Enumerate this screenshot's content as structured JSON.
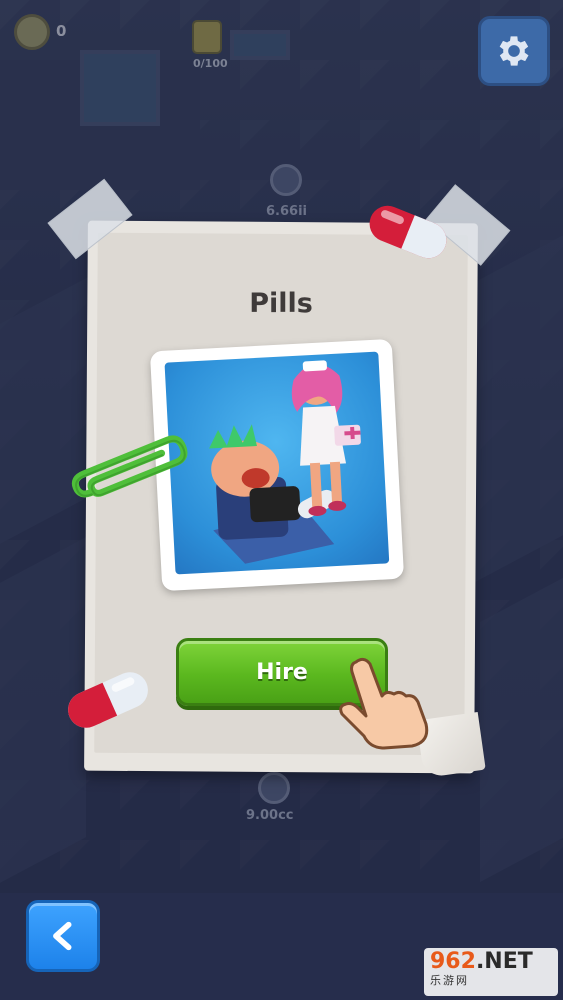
{
  "hud": {
    "coins": "0",
    "box_progress": "0/100",
    "settings_icon": "gear-icon"
  },
  "scene": {
    "label_top": "6.66ii",
    "label_bottom": "9.00cc"
  },
  "card": {
    "title": "Pills",
    "hire_label": "Hire"
  },
  "nav": {
    "back_icon": "chevron-left-icon"
  },
  "watermark": {
    "brand_num": "962",
    "brand_net": ".NET",
    "subtitle": "乐游网"
  },
  "colors": {
    "hire_green": "#5bb81f",
    "back_blue": "#1d82ea",
    "paper": "#e8e5e0",
    "background": "#2c3556"
  }
}
